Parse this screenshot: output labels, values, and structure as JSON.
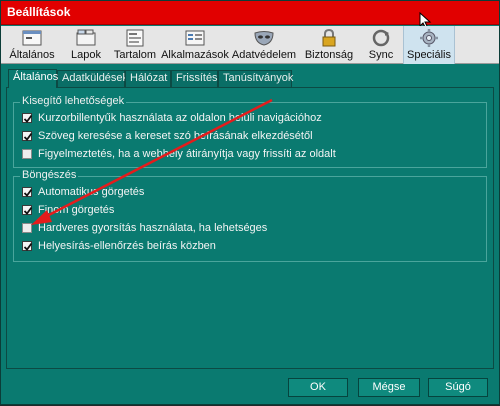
{
  "window": {
    "title": "Beállítások"
  },
  "toolbar": {
    "items": [
      {
        "label": "Általános",
        "icon": "switch-icon"
      },
      {
        "label": "Lapok",
        "icon": "tabs-icon"
      },
      {
        "label": "Tartalom",
        "icon": "content-icon"
      },
      {
        "label": "Alkalmazások",
        "icon": "applications-icon"
      },
      {
        "label": "Adatvédelem",
        "icon": "privacy-mask-icon"
      },
      {
        "label": "Biztonság",
        "icon": "lock-icon"
      },
      {
        "label": "Sync",
        "icon": "sync-icon"
      },
      {
        "label": "Speciális",
        "icon": "gear-icon"
      }
    ],
    "active": "Speciális"
  },
  "tabs": [
    {
      "label": "Általános",
      "active": true
    },
    {
      "label": "Adatküldések"
    },
    {
      "label": "Hálózat"
    },
    {
      "label": "Frissítés"
    },
    {
      "label": "Tanúsítványok"
    }
  ],
  "groups": {
    "accessibility": {
      "title": "Kisegítő lehetőségek",
      "items": [
        {
          "label": "Kurzorbillentyűk használata az oldalon belüli navigációhoz",
          "checked": true
        },
        {
          "label": "Szöveg keresése a kereset szó beírásának elkezdésétől",
          "checked": true
        },
        {
          "label": "Figyelmeztetés, ha a webhely átirányítja vagy frissíti az oldalt",
          "checked": false
        }
      ]
    },
    "browsing": {
      "title": "Böngészés",
      "items": [
        {
          "label": "Automatikus görgetés",
          "checked": true
        },
        {
          "label": "Finom görgetés",
          "checked": true
        },
        {
          "label": "Hardveres gyorsítás használata, ha lehetséges",
          "checked": false
        },
        {
          "label": "Helyesírás-ellenőrzés beírás közben",
          "checked": true
        }
      ]
    }
  },
  "buttons": {
    "ok": "OK",
    "cancel": "Mégse",
    "help": "Súgó"
  },
  "colors": {
    "titlebar": "#e10000",
    "background": "#0a7a70",
    "annotation_arrow": "#e41c1c"
  }
}
